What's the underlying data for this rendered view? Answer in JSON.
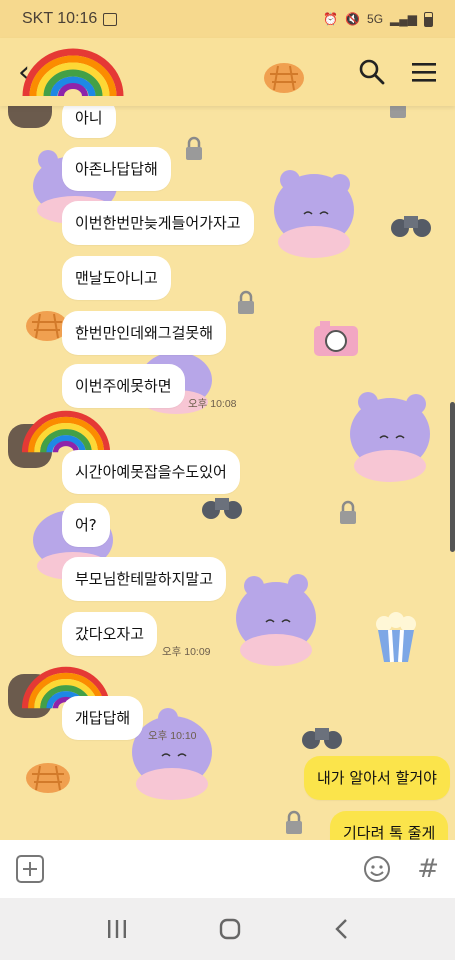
{
  "status_bar": {
    "carrier_time": "SKT 10:16",
    "network": "5G"
  },
  "header": {
    "back_icon": "chevron-left-icon",
    "search_icon": "search-icon",
    "menu_icon": "hamburger-menu-icon"
  },
  "messages": [
    {
      "text": "아니",
      "side": "left"
    },
    {
      "text": "아존나답답해",
      "side": "left"
    },
    {
      "text": "이번한번만늦게들어가자고",
      "side": "left"
    },
    {
      "text": "맨날도아니고",
      "side": "left"
    },
    {
      "text": "한번만인데왜그걸못해",
      "side": "left"
    },
    {
      "text": "이번주에못하면",
      "side": "left",
      "time": "오후 10:08"
    },
    {
      "text": "시간아예못잡을수도있어",
      "side": "left"
    },
    {
      "text": "어?",
      "side": "left"
    },
    {
      "text": "부모님한테말하지말고",
      "side": "left"
    },
    {
      "text": "갔다오자고",
      "side": "left",
      "time": "오후 10:09"
    },
    {
      "text": "개답답해",
      "side": "left",
      "time": "오후 10:10"
    },
    {
      "text": "내가 알아서 할거야",
      "side": "right"
    },
    {
      "text": "기다려 톡 줄게",
      "side": "right"
    }
  ],
  "input_bar": {
    "hash_label": "#",
    "add_icon": "plus-box-icon",
    "emoji_icon": "emoji-icon"
  },
  "colors": {
    "background": "#f9e3a0",
    "header": "#f9e19a",
    "my_bubble": "#fbe44b",
    "their_bubble": "#ffffff"
  }
}
